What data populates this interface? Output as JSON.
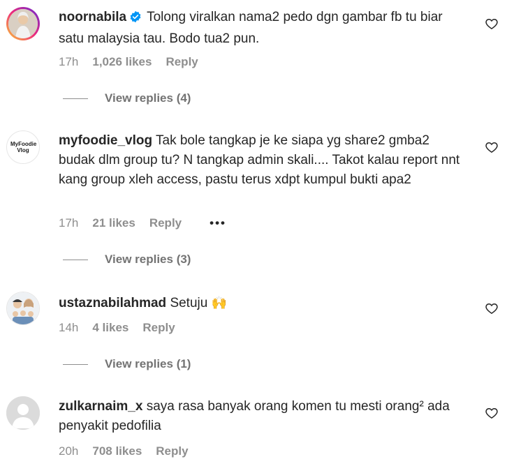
{
  "colors": {
    "accent": "#0095f6",
    "text": "#262626",
    "muted": "#8e8e8e"
  },
  "comments": [
    {
      "username": "noornabila",
      "verified": true,
      "text": "Tolong viralkan nama2 pedo dgn gambar fb tu biar satu malaysia tau. Bodo tua2 pun.",
      "time": "17h",
      "likes": "1,026 likes",
      "reply": "Reply",
      "view_replies": "View replies (4)"
    },
    {
      "username": "myfoodie_vlog",
      "avatar_text": "MyFoodie Vlog",
      "text": "Tak bole tangkap je ke siapa yg share2 gmba2 budak dlm group tu? N tangkap admin skali.... Takot kalau report nnt kang group xleh access, pastu terus xdpt kumpul bukti apa2",
      "time": "17h",
      "likes": "21 likes",
      "reply": "Reply",
      "more": "•••",
      "view_replies": "View replies (3)"
    },
    {
      "username": "ustaznabilahmad",
      "text": "Setuju",
      "emoji": "🙌",
      "time": "14h",
      "likes": "4 likes",
      "reply": "Reply",
      "view_replies": "View replies (1)"
    },
    {
      "username": "zulkarnaim_x",
      "text": "saya rasa banyak orang komen tu mesti orang² ada penyakit pedofilia",
      "time": "20h",
      "likes": "708 likes",
      "reply": "Reply"
    }
  ]
}
